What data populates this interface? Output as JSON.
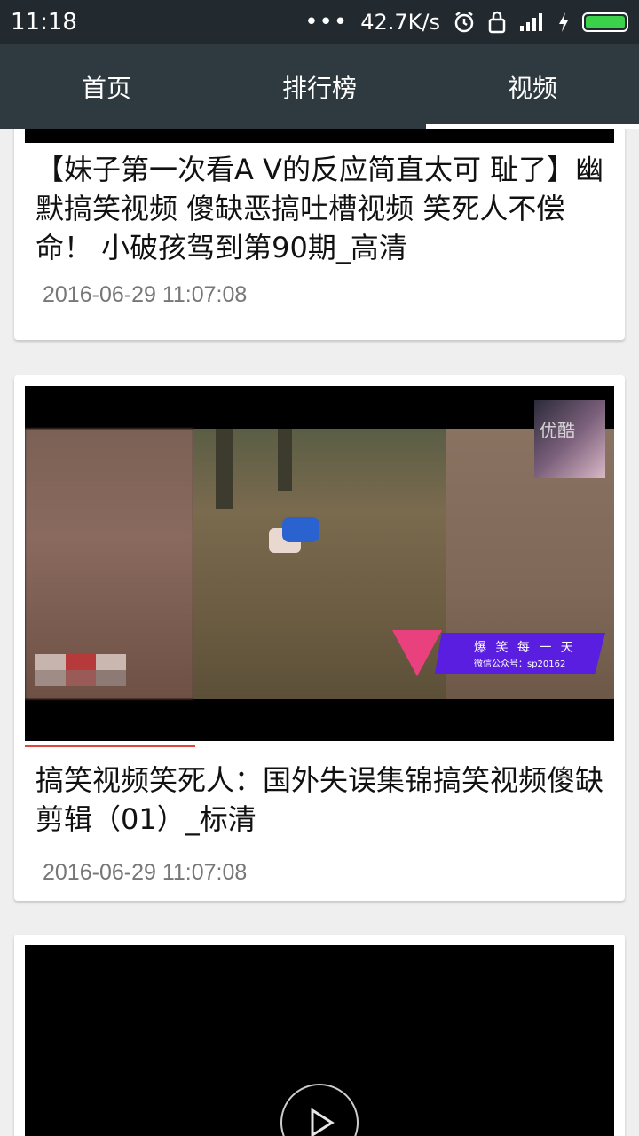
{
  "status_bar": {
    "time": "11:18",
    "network_speed": "42.7K/s",
    "icons": [
      "more-dots-icon",
      "alarm-icon",
      "lock-icon",
      "signal-icon",
      "charging-icon",
      "battery-icon"
    ],
    "battery_color": "#3bd14b"
  },
  "nav": {
    "tabs": [
      {
        "label": "首页"
      },
      {
        "label": "排行榜"
      },
      {
        "label": "视频"
      }
    ],
    "active_tab": "视频"
  },
  "feed": {
    "items": [
      {
        "title": "【妹子第一次看A V的反应简直太可 耻了】幽默搞笑视频 傻缺恶搞吐槽视频 笑死人不偿命！ 小破孩驾到第90期_高清",
        "date": "2016-06-29 11:07:08"
      },
      {
        "title": "搞笑视频笑死人：国外失误集锦搞笑视频傻缺剪辑（01）_标清",
        "date": "2016-06-29 11:07:08",
        "video_overlay": {
          "watermark": "优酷",
          "banner_title": "爆 笑 每 一 天",
          "banner_subtitle": "微信公众号：sp20162"
        },
        "progress": 0.34
      },
      {
        "title": "",
        "date": ""
      }
    ]
  }
}
